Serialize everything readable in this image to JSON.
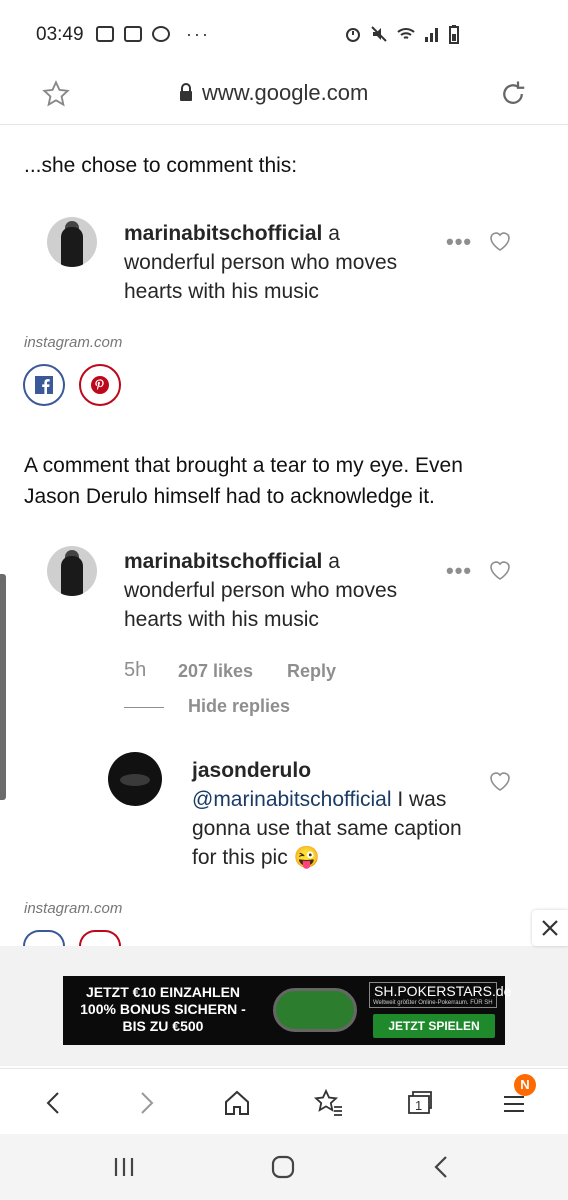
{
  "status_bar": {
    "time": "03:49",
    "dots": "···"
  },
  "address_bar": {
    "url": "www.google.com"
  },
  "article": {
    "heading_1": "...she chose to comment this:",
    "embed_1": {
      "username": "marinabitschofficial",
      "comment": " a wonderful person who moves hearts with his music",
      "more": "•••",
      "source": "instagram.com"
    },
    "heading_2_line1": "A comment that brought a tear to my eye. Even",
    "heading_2_line2": "Jason Derulo himself had to acknowledge it.",
    "embed_2": {
      "username": "marinabitschofficial",
      "comment": " a wonderful person who moves hearts with his music",
      "more": "•••",
      "time": "5h",
      "likes": "207 likes",
      "reply": "Reply",
      "hide_replies": "Hide replies",
      "reply_username": "jasonderulo",
      "reply_mention": "@marinabitschofficial",
      "reply_text": " I was gonna use that same caption for this pic 😜",
      "source": "instagram.com"
    }
  },
  "ad": {
    "line1": "JETZT €10 EINZAHLEN",
    "line2": "100% BONUS SICHERN -",
    "line3": "BIS ZU €500",
    "logo": "SH.POKERSTARS.de",
    "logo_sub": "Weltweit größter Online-Pokerraum. FÜR SH",
    "cta": "JETZT SPIELEN",
    "close_icon": "close-icon"
  },
  "toolbar": {
    "tabs_count": "1",
    "badge": "N"
  },
  "colors": {
    "facebook": "#3b5998",
    "pinterest": "#bd081c",
    "badge": "#ff6a00",
    "mention": "#1a3b66"
  }
}
